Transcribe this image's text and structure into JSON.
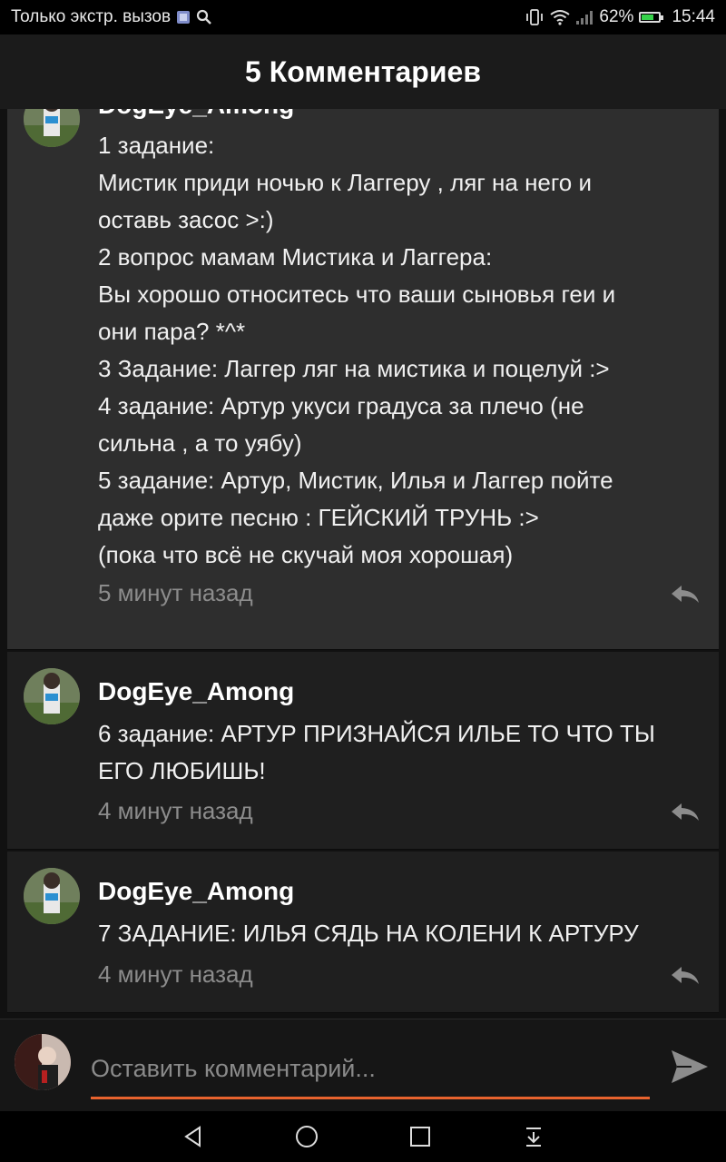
{
  "status_bar": {
    "carrier_text": "Только экстр. вызов",
    "battery_percent": "62%",
    "battery_level": 0.62,
    "time": "15:44",
    "icons": [
      "sim-icon",
      "search-icon",
      "vibrate-icon",
      "wifi-icon",
      "signal-icon",
      "battery-icon"
    ]
  },
  "header": {
    "title": "5 Комментариев"
  },
  "comments": [
    {
      "author": "DogEye_Among",
      "lines": [
        "1 задание:",
        "Мистик приди ночью к Лаггеру , ляг на него и",
        "оставь засос >:)",
        "2 вопрос мамам Мистика и Лаггера:",
        "Вы хорошо относитесь что ваши сыновья геи и",
        "они пара? *^*",
        "3 Задание: Лаггер ляг на мистика и поцелуй :>",
        "4 задание: Артур укуси градуса за плечо (не",
        "сильна , а то уябу)",
        "5 задание: Артур, Мистик, Илья и Лаггер пойте",
        "даже орите песню : ГЕЙСКИЙ ТРУНЬ :>",
        "(пока что всё не скучай моя хорошая)"
      ],
      "time": "5 минут назад"
    },
    {
      "author": "DogEye_Among",
      "lines": [
        "6 задание: АРТУР ПРИЗНАЙСЯ ИЛЬЕ ТО ЧТО ТЫ",
        "ЕГО ЛЮБИШЬ!"
      ],
      "time": "4 минут назад"
    },
    {
      "author": "DogEye_Among",
      "lines": [
        "7 ЗАДАНИЕ: ИЛЬЯ СЯДЬ НА КОЛЕНИ К АРТУРУ"
      ],
      "time": "4 минут назад"
    }
  ],
  "compose": {
    "placeholder": "Оставить комментарий..."
  },
  "colors": {
    "accent": "#e8632e",
    "background": "#111111",
    "highlight_comment": "#2e2e2e"
  },
  "nav_icons": [
    "back-icon",
    "home-icon",
    "recents-icon",
    "notification-pull-icon"
  ]
}
